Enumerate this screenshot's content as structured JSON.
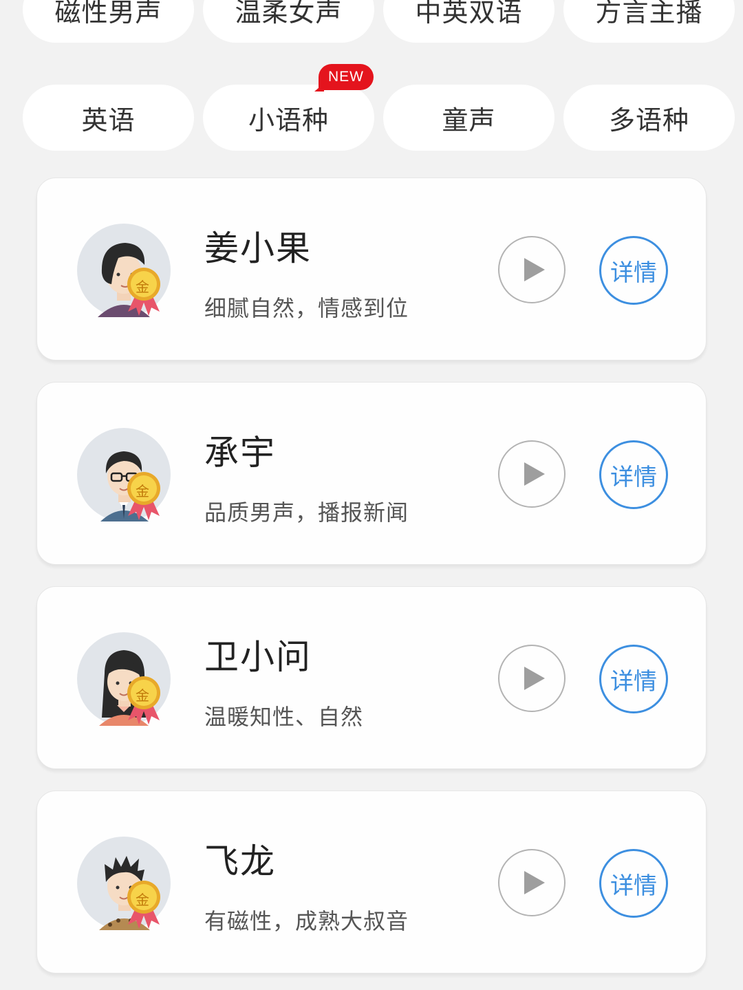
{
  "category_row1": [
    "磁性男声",
    "温柔女声",
    "中英双语",
    "方言主播"
  ],
  "category_row2": [
    "英语",
    "小语种",
    "童声",
    "多语种"
  ],
  "new_badge": "NEW",
  "medal_text": "金",
  "colors": {
    "accent_blue": "#3d8fe0",
    "badge_red": "#e4141d",
    "medal_gold": "#f4c431",
    "ribbon_red": "#e8556a"
  },
  "voices": [
    {
      "name": "姜小果",
      "desc": "细腻自然，情感到位",
      "detail_label": "详情",
      "avatar": "female-short-hair-avatar"
    },
    {
      "name": "承宇",
      "desc": "品质男声，播报新闻",
      "detail_label": "详情",
      "avatar": "male-glasses-avatar"
    },
    {
      "name": "卫小问",
      "desc": "温暖知性、自然",
      "detail_label": "详情",
      "avatar": "female-long-hair-avatar"
    },
    {
      "name": "飞龙",
      "desc": "有磁性，成熟大叔音",
      "detail_label": "详情",
      "avatar": "male-spiky-hair-avatar"
    }
  ]
}
